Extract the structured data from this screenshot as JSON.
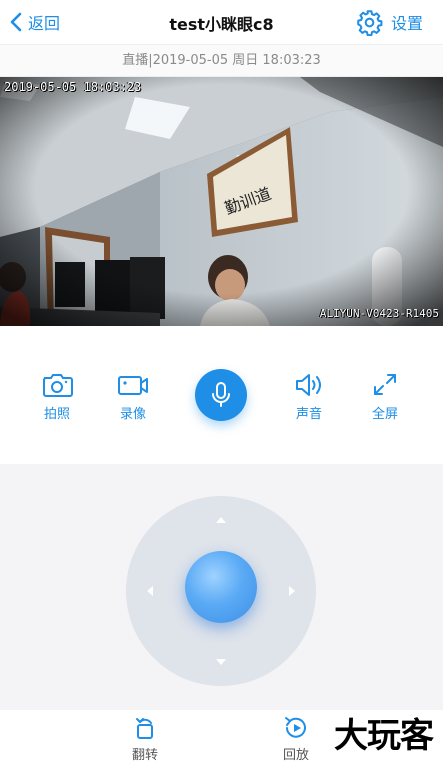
{
  "header": {
    "back_label": "返回",
    "title": "test小眯眼c8",
    "settings_label": "设置"
  },
  "status": {
    "text": "直播|2019-05-05 周日 18:03:23"
  },
  "video": {
    "osd_timestamp": "2019-05-05  18:03:23",
    "osd_device_id": "ALIYUN-V0423-R1405"
  },
  "toolbar": {
    "snapshot_label": "拍照",
    "record_label": "录像",
    "sound_label": "声音",
    "fullscreen_label": "全屏"
  },
  "bottom": {
    "flip_label": "翻转",
    "playback_label": "回放"
  },
  "watermark": {
    "text": "大玩客"
  },
  "colors": {
    "accent": "#1e8ee6",
    "ptz_ring": "#dfe3ea",
    "ptz_background": "#f4f4f6"
  },
  "icons": {
    "back": "chevron-left-icon",
    "settings": "gear-icon",
    "snapshot": "camera-icon",
    "record": "video-camera-icon",
    "talk": "microphone-icon",
    "sound": "speaker-icon",
    "fullscreen": "expand-icon",
    "flip": "rotate-icon",
    "playback": "replay-icon"
  }
}
